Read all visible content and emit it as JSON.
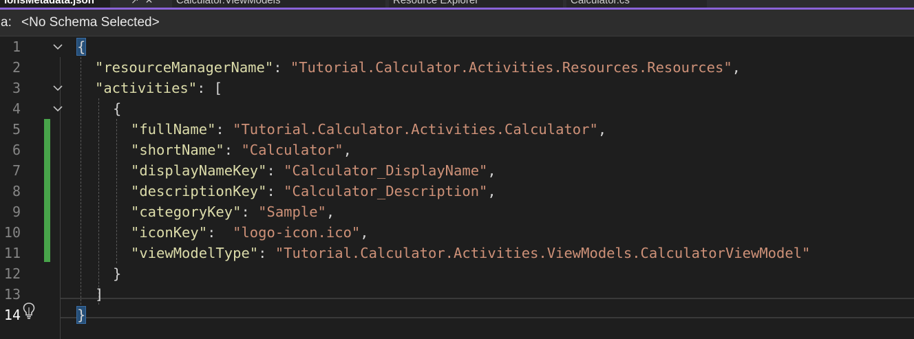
{
  "tabs": {
    "active": "ionsMetadata.json",
    "others": [
      "Calculator.ViewModels",
      "Resource Explorer",
      "Calculator.cs"
    ]
  },
  "schema_bar": {
    "label": "a:",
    "selected": "<No Schema Selected>"
  },
  "editor": {
    "line_numbers": [
      "1",
      "2",
      "3",
      "4",
      "5",
      "6",
      "7",
      "8",
      "9",
      "10",
      "11",
      "12",
      "13",
      "14"
    ],
    "lines": [
      {
        "parts": [
          {
            "t": "{",
            "c": "brace"
          }
        ]
      },
      {
        "parts": [
          {
            "t": "\"resourceManagerName\"",
            "c": "key"
          },
          {
            "t": ": ",
            "c": "pun"
          },
          {
            "t": "\"Tutorial.Calculator.Activities.Resources.Resources\"",
            "c": "str"
          },
          {
            "t": ",",
            "c": "pun"
          }
        ]
      },
      {
        "parts": [
          {
            "t": "\"activities\"",
            "c": "key"
          },
          {
            "t": ": [",
            "c": "pun"
          }
        ]
      },
      {
        "parts": [
          {
            "t": "{",
            "c": "pun"
          }
        ]
      },
      {
        "parts": [
          {
            "t": "\"fullName\"",
            "c": "key"
          },
          {
            "t": ": ",
            "c": "pun"
          },
          {
            "t": "\"Tutorial.Calculator.Activities.Calculator\"",
            "c": "str"
          },
          {
            "t": ",",
            "c": "pun"
          }
        ]
      },
      {
        "parts": [
          {
            "t": "\"shortName\"",
            "c": "key"
          },
          {
            "t": ": ",
            "c": "pun"
          },
          {
            "t": "\"Calculator\"",
            "c": "str"
          },
          {
            "t": ",",
            "c": "pun"
          }
        ]
      },
      {
        "parts": [
          {
            "t": "\"displayNameKey\"",
            "c": "key"
          },
          {
            "t": ": ",
            "c": "pun"
          },
          {
            "t": "\"Calculator_DisplayName\"",
            "c": "str"
          },
          {
            "t": ",",
            "c": "pun"
          }
        ]
      },
      {
        "parts": [
          {
            "t": "\"descriptionKey\"",
            "c": "key"
          },
          {
            "t": ": ",
            "c": "pun"
          },
          {
            "t": "\"Calculator_Description\"",
            "c": "str"
          },
          {
            "t": ",",
            "c": "pun"
          }
        ]
      },
      {
        "parts": [
          {
            "t": "\"categoryKey\"",
            "c": "key"
          },
          {
            "t": ": ",
            "c": "pun"
          },
          {
            "t": "\"Sample\"",
            "c": "str"
          },
          {
            "t": ",",
            "c": "pun"
          }
        ]
      },
      {
        "parts": [
          {
            "t": "\"iconKey\"",
            "c": "key"
          },
          {
            "t": ":  ",
            "c": "pun"
          },
          {
            "t": "\"logo-icon.ico\"",
            "c": "str"
          },
          {
            "t": ",",
            "c": "pun"
          }
        ]
      },
      {
        "parts": [
          {
            "t": "\"viewModelType\"",
            "c": "key"
          },
          {
            "t": ": ",
            "c": "pun"
          },
          {
            "t": "\"Tutorial.Calculator.Activities.ViewModels.CalculatorViewModel\"",
            "c": "str"
          }
        ]
      },
      {
        "parts": [
          {
            "t": "}",
            "c": "pun"
          }
        ]
      },
      {
        "parts": [
          {
            "t": "]",
            "c": "pun"
          }
        ]
      },
      {
        "parts": [
          {
            "t": "}",
            "c": "brace"
          }
        ]
      }
    ],
    "current_line": "14",
    "changed_lines": [
      "5",
      "6",
      "7",
      "8",
      "9",
      "10",
      "11"
    ]
  },
  "icons": {
    "fold": "chevron-down-icon",
    "lightbulb": "lightbulb-icon",
    "tab_pin": "pin-icon",
    "tab_close": "close-icon"
  },
  "colors": {
    "accent": "#8b63d9",
    "key": "#dcdcaa",
    "string": "#ce9178",
    "change_bar": "#48a44a"
  }
}
